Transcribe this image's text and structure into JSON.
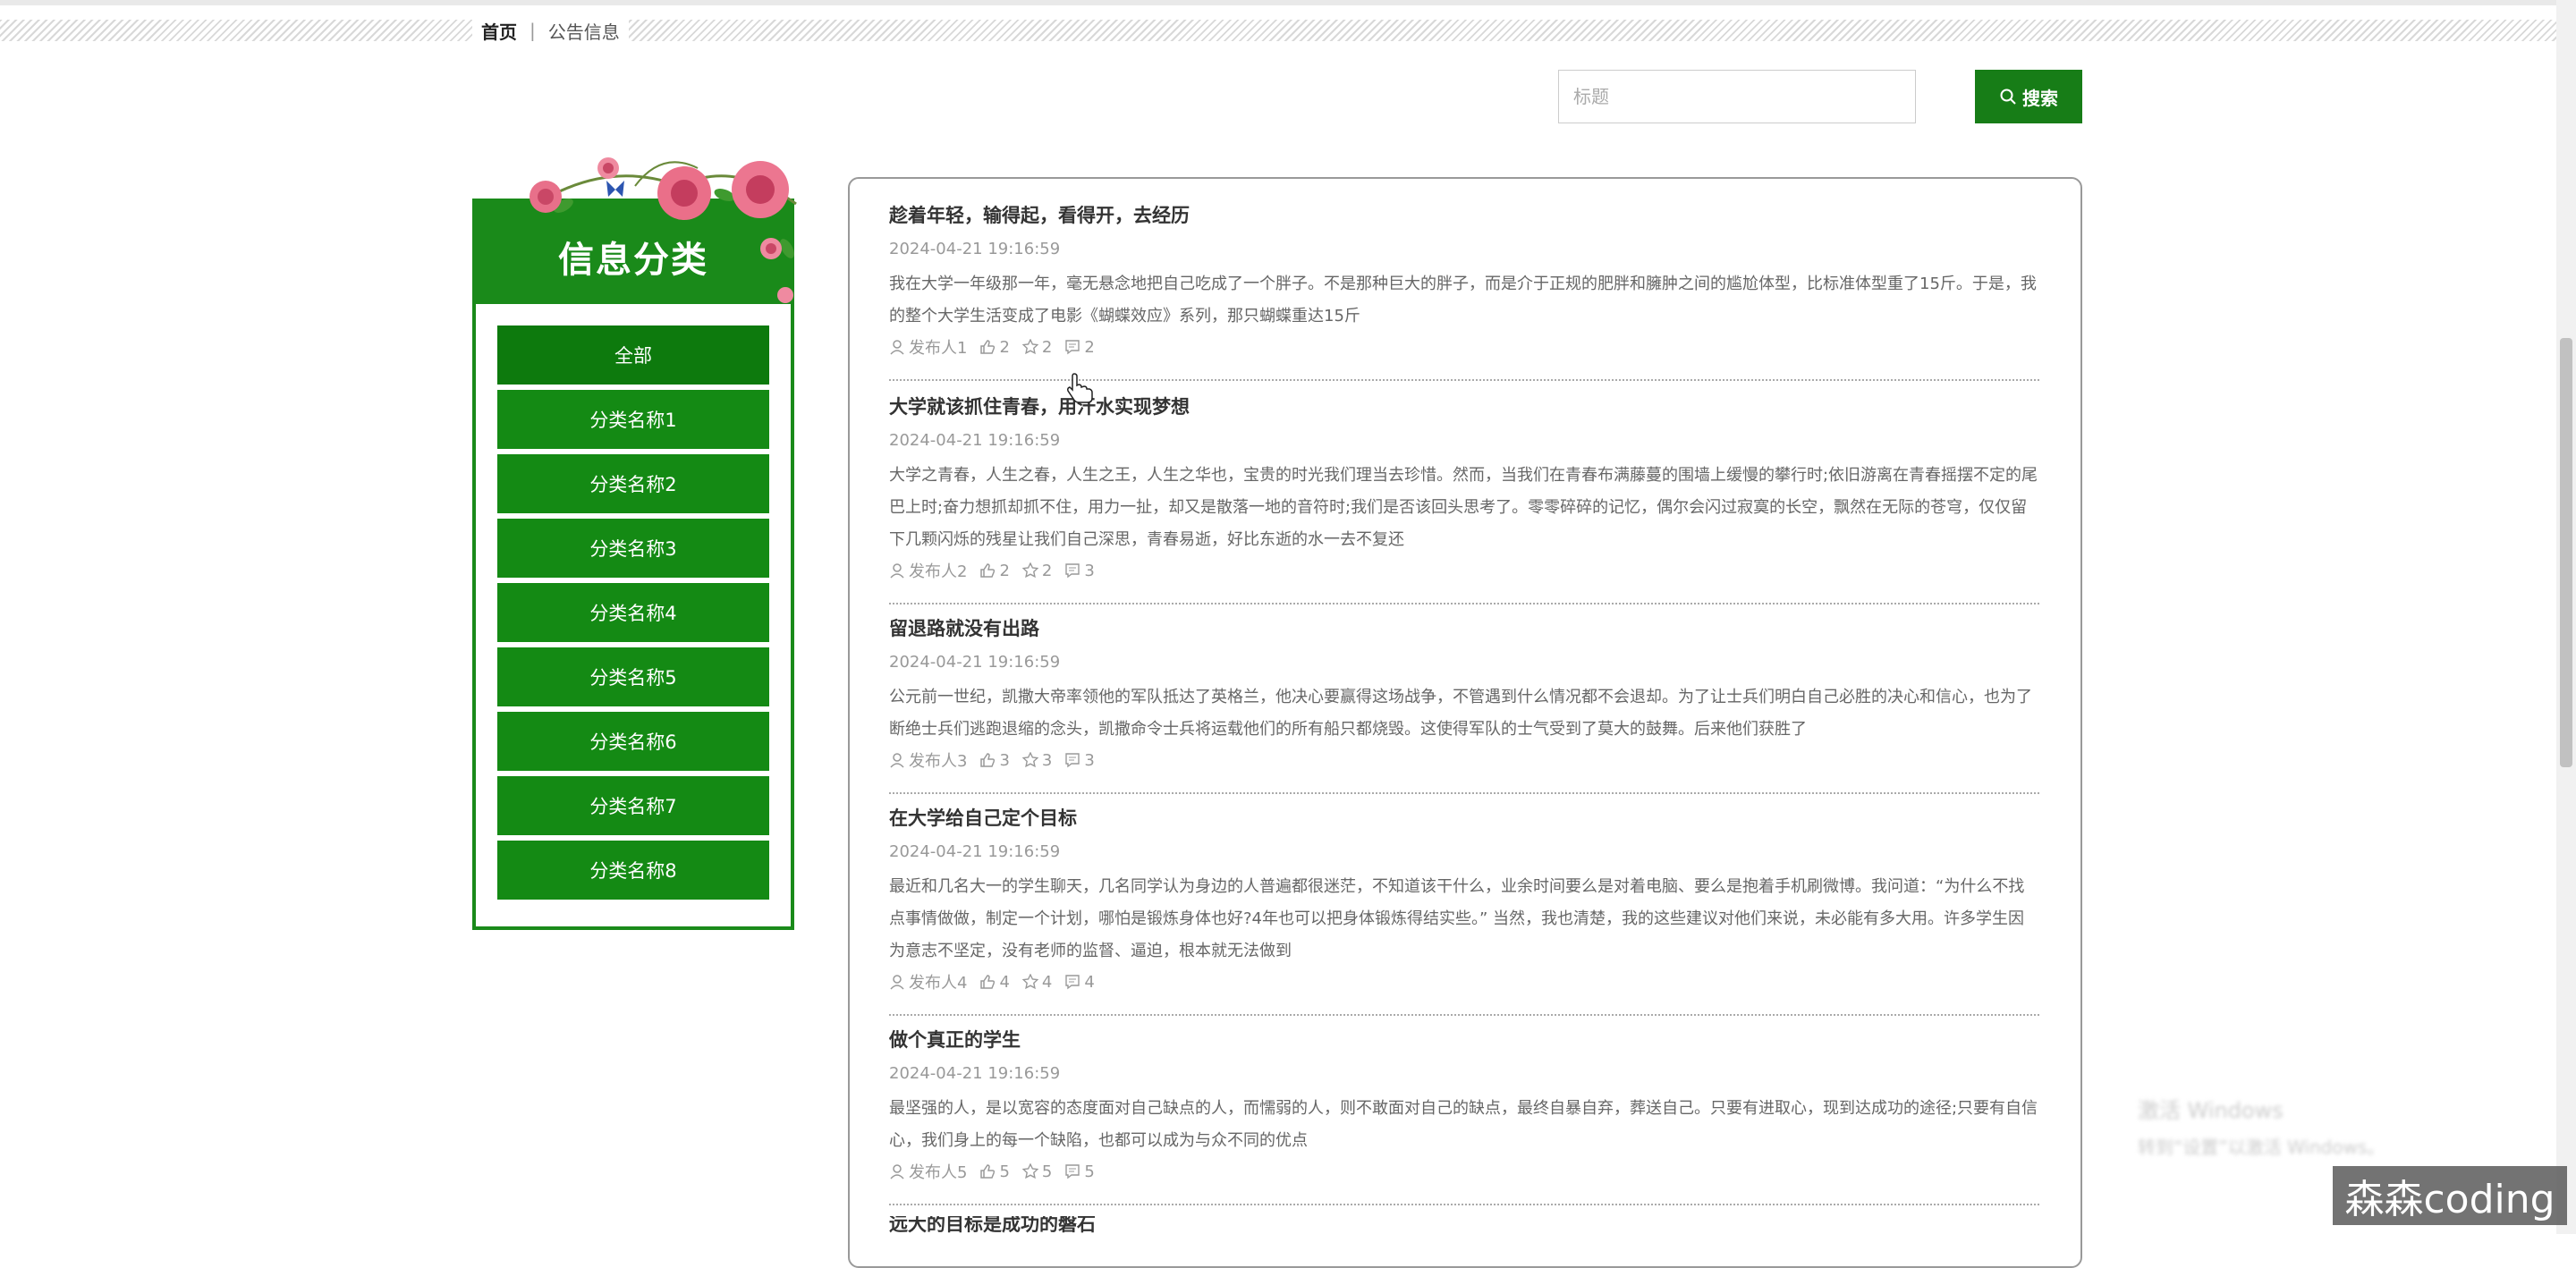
{
  "breadcrumb": {
    "home": "首页",
    "separator": "|",
    "current": "公告信息"
  },
  "search": {
    "placeholder": "标题",
    "button_label": "搜索"
  },
  "sidebar": {
    "title": "信息分类",
    "categories": [
      "全部",
      "分类名称1",
      "分类名称2",
      "分类名称3",
      "分类名称4",
      "分类名称5",
      "分类名称6",
      "分类名称7",
      "分类名称8"
    ],
    "active_index": 0
  },
  "articles": [
    {
      "title": "趁着年轻，输得起，看得开，去经历",
      "date": "2024-04-21 19:16:59",
      "desc": "我在大学一年级那一年，毫无悬念地把自己吃成了一个胖子。不是那种巨大的胖子，而是介于正规的肥胖和臃肿之间的尴尬体型，比标准体型重了15斤。于是，我的整个大学生活变成了电影《蝴蝶效应》系列，那只蝴蝶重达15斤",
      "author": "发布人1",
      "likes": "2",
      "collects": "2",
      "comments": "2"
    },
    {
      "title": "大学就该抓住青春，用汗水实现梦想",
      "date": "2024-04-21 19:16:59",
      "desc": "大学之青春，人生之春，人生之王，人生之华也，宝贵的时光我们理当去珍惜。然而，当我们在青春布满藤蔓的围墙上缓慢的攀行时;依旧游离在青春摇摆不定的尾巴上时;奋力想抓却抓不住，用力一扯，却又是散落一地的音符时;我们是否该回头思考了。零零碎碎的记忆，偶尔会闪过寂寞的长空，飘然在无际的苍穹，仅仅留下几颗闪烁的残星让我们自己深思，青春易逝，好比东逝的水一去不复还",
      "author": "发布人2",
      "likes": "2",
      "collects": "2",
      "comments": "3"
    },
    {
      "title": "留退路就没有出路",
      "date": "2024-04-21 19:16:59",
      "desc": "公元前一世纪，凯撒大帝率领他的军队抵达了英格兰，他决心要赢得这场战争，不管遇到什么情况都不会退却。为了让士兵们明白自己必胜的决心和信心，也为了断绝士兵们逃跑退缩的念头，凯撒命令士兵将运载他们的所有船只都烧毁。这使得军队的士气受到了莫大的鼓舞。后来他们获胜了",
      "author": "发布人3",
      "likes": "3",
      "collects": "3",
      "comments": "3"
    },
    {
      "title": "在大学给自己定个目标",
      "date": "2024-04-21 19:16:59",
      "desc": "最近和几名大一的学生聊天，几名同学认为身边的人普遍都很迷茫，不知道该干什么，业余时间要么是对着电脑、要么是抱着手机刷微博。我问道：“为什么不找点事情做做，制定一个计划，哪怕是锻炼身体也好?4年也可以把身体锻炼得结实些。” 当然，我也清楚，我的这些建议对他们来说，未必能有多大用。许多学生因为意志不坚定，没有老师的监督、逼迫，根本就无法做到",
      "author": "发布人4",
      "likes": "4",
      "collects": "4",
      "comments": "4"
    },
    {
      "title": "做个真正的学生",
      "date": "2024-04-21 19:16:59",
      "desc": "最坚强的人，是以宽容的态度面对自己缺点的人，而懦弱的人，则不敢面对自己的缺点，最终自暴自弃，葬送自己。只要有进取心，现到达成功的途径;只要有自信心，我们身上的每一个缺陷，也都可以成为与众不同的优点",
      "author": "发布人5",
      "likes": "5",
      "collects": "5",
      "comments": "5"
    },
    {
      "title": "远大的目标是成功的磐石",
      "date": "",
      "desc": "",
      "author": "",
      "likes": "",
      "collects": "",
      "comments": ""
    }
  ],
  "watermark": "森森coding",
  "activation": {
    "line1": "激活 Windows",
    "line2": "转到“设置”以激活 Windows。"
  },
  "colors": {
    "primary_green": "#1a8a1a",
    "button_green": "#177d17",
    "text": "#333333",
    "muted": "#999999"
  }
}
